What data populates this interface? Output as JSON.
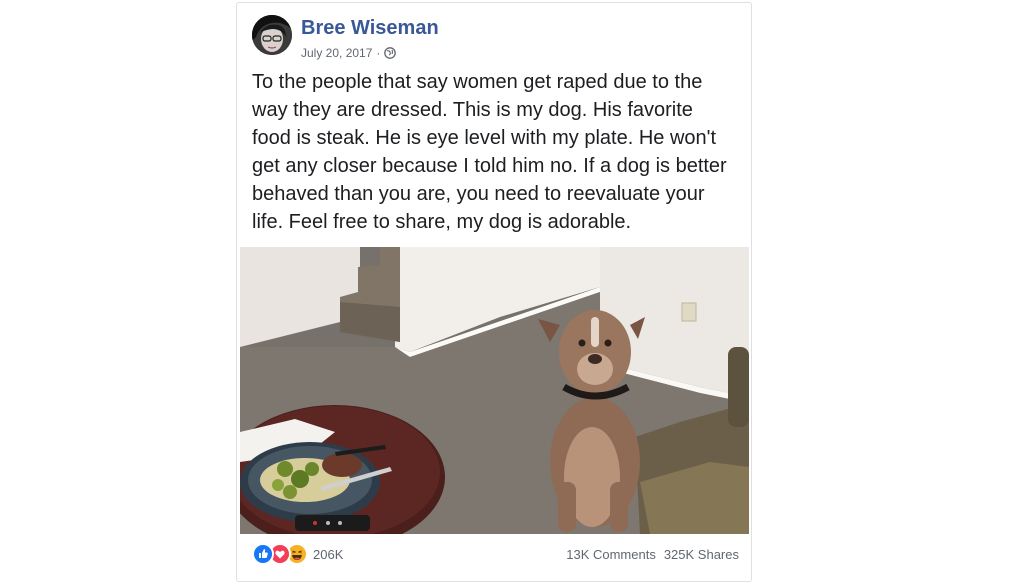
{
  "post": {
    "author": "Bree Wiseman",
    "date": "July 20, 2017",
    "separator": "·",
    "privacy_icon": "globe-icon",
    "text": "To the people that say women get raped due to the\nway they are dressed. This is my dog. His favorite\nfood is steak. He is eye level with my plate. He won't\nget any closer because I told him no. If a dog is better\nbehaved than you are, you need to reevaluate your\nlife. Feel free to share, my dog is adorable."
  },
  "footer": {
    "reaction_icons": [
      "like-icon",
      "love-icon",
      "haha-icon"
    ],
    "reaction_count": "206K",
    "comments": "13K Comments",
    "shares": "325K Shares"
  },
  "colors": {
    "author_link": "#385898",
    "text": "#1c1e21",
    "meta": "#616770",
    "like": "#1877f2",
    "love": "#f33e58",
    "haha": "#f7b125"
  }
}
